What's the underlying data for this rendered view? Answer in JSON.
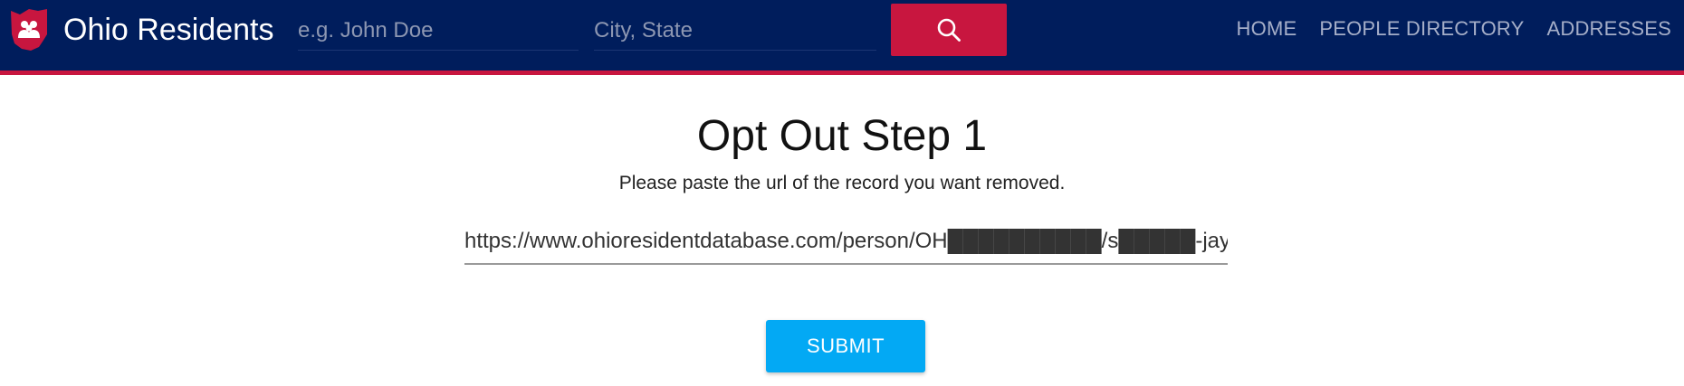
{
  "navbar": {
    "brand": "Ohio Residents",
    "logo_icon": "ohio-state-people-icon",
    "name_search": {
      "placeholder": "e.g. John Doe",
      "value": ""
    },
    "location_search": {
      "placeholder": "City, State",
      "value": ""
    },
    "search_button_icon": "search-icon",
    "links": [
      {
        "label": "HOME"
      },
      {
        "label": "PEOPLE DIRECTORY"
      },
      {
        "label": "ADDRESSES"
      }
    ]
  },
  "main": {
    "title": "Opt Out Step 1",
    "instructions": "Please paste the url of the record you want removed.",
    "url_field": {
      "value": "https://www.ohioresidentdatabase.com/person/OH██████████/s█████-jayden"
    },
    "submit_label": "SUBMIT"
  },
  "colors": {
    "navbar_bg": "#001d5c",
    "accent_red": "#c8163f",
    "submit_blue": "#03a9f4"
  }
}
